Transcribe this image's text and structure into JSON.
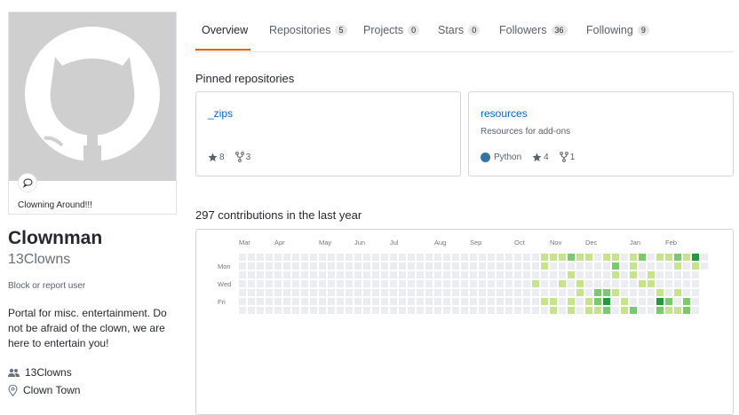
{
  "status": {
    "message": "Clowning Around!!!"
  },
  "profile": {
    "name": "Clownman",
    "username": "13Clowns",
    "block_link": "Block or report user",
    "bio": "Portal for misc. entertainment. Do not be afraid of the clown, we are here to entertain you!",
    "organization": "13Clowns",
    "location": "Clown Town"
  },
  "tabs": [
    {
      "label": "Overview"
    },
    {
      "label": "Repositories",
      "count": "5"
    },
    {
      "label": "Projects",
      "count": "0"
    },
    {
      "label": "Stars",
      "count": "0"
    },
    {
      "label": "Followers",
      "count": "36"
    },
    {
      "label": "Following",
      "count": "9"
    }
  ],
  "pinned": {
    "heading": "Pinned repositories",
    "repos": [
      {
        "name": "_zips",
        "description": "",
        "language": "",
        "stars": "8",
        "forks": "3"
      },
      {
        "name": "resources",
        "description": "Resources for add-ons",
        "language": "Python",
        "language_color": "#3572A5",
        "stars": "4",
        "forks": "1"
      }
    ]
  },
  "contributions": {
    "heading": "297 contributions in the last year",
    "months": [
      "Mar",
      "Apr",
      "May",
      "Jun",
      "Jul",
      "Aug",
      "Sep",
      "Oct",
      "Nov",
      "Dec",
      "Jan",
      "Feb"
    ],
    "weekdays": [
      "Mon",
      "Wed",
      "Fri"
    ],
    "level_colors": [
      "#ebedf0",
      "#c6e48b",
      "#7bc96f",
      "#239a3b",
      "#196127"
    ],
    "weeks_with_levels": [
      [
        33,
        [
          0,
          0,
          0,
          1,
          0,
          0,
          0
        ]
      ],
      [
        34,
        [
          1,
          1,
          0,
          0,
          0,
          1,
          0
        ]
      ],
      [
        35,
        [
          1,
          0,
          0,
          0,
          0,
          1,
          1
        ]
      ],
      [
        36,
        [
          1,
          0,
          0,
          1,
          0,
          0,
          0
        ]
      ],
      [
        37,
        [
          2,
          0,
          1,
          0,
          0,
          1,
          1
        ]
      ],
      [
        38,
        [
          1,
          0,
          0,
          1,
          1,
          0,
          0
        ]
      ],
      [
        39,
        [
          1,
          0,
          0,
          0,
          0,
          1,
          1
        ]
      ],
      [
        40,
        [
          0,
          0,
          0,
          0,
          2,
          2,
          1
        ]
      ],
      [
        41,
        [
          1,
          0,
          0,
          0,
          2,
          3,
          2
        ]
      ],
      [
        42,
        [
          1,
          2,
          1,
          0,
          1,
          0,
          0
        ]
      ],
      [
        43,
        [
          0,
          0,
          0,
          0,
          0,
          1,
          1
        ]
      ],
      [
        44,
        [
          1,
          1,
          1,
          0,
          0,
          0,
          2
        ]
      ],
      [
        45,
        [
          2,
          0,
          0,
          1,
          0,
          0,
          0
        ]
      ],
      [
        46,
        [
          0,
          0,
          1,
          1,
          0,
          0,
          0
        ]
      ],
      [
        47,
        [
          1,
          0,
          0,
          0,
          1,
          3,
          2
        ]
      ],
      [
        48,
        [
          1,
          0,
          0,
          0,
          0,
          2,
          1
        ]
      ],
      [
        49,
        [
          2,
          1,
          0,
          0,
          1,
          0,
          1
        ]
      ],
      [
        50,
        [
          1,
          0,
          0,
          0,
          0,
          2,
          2
        ]
      ],
      [
        51,
        [
          3,
          1,
          0,
          0,
          0,
          0,
          0
        ]
      ]
    ]
  }
}
